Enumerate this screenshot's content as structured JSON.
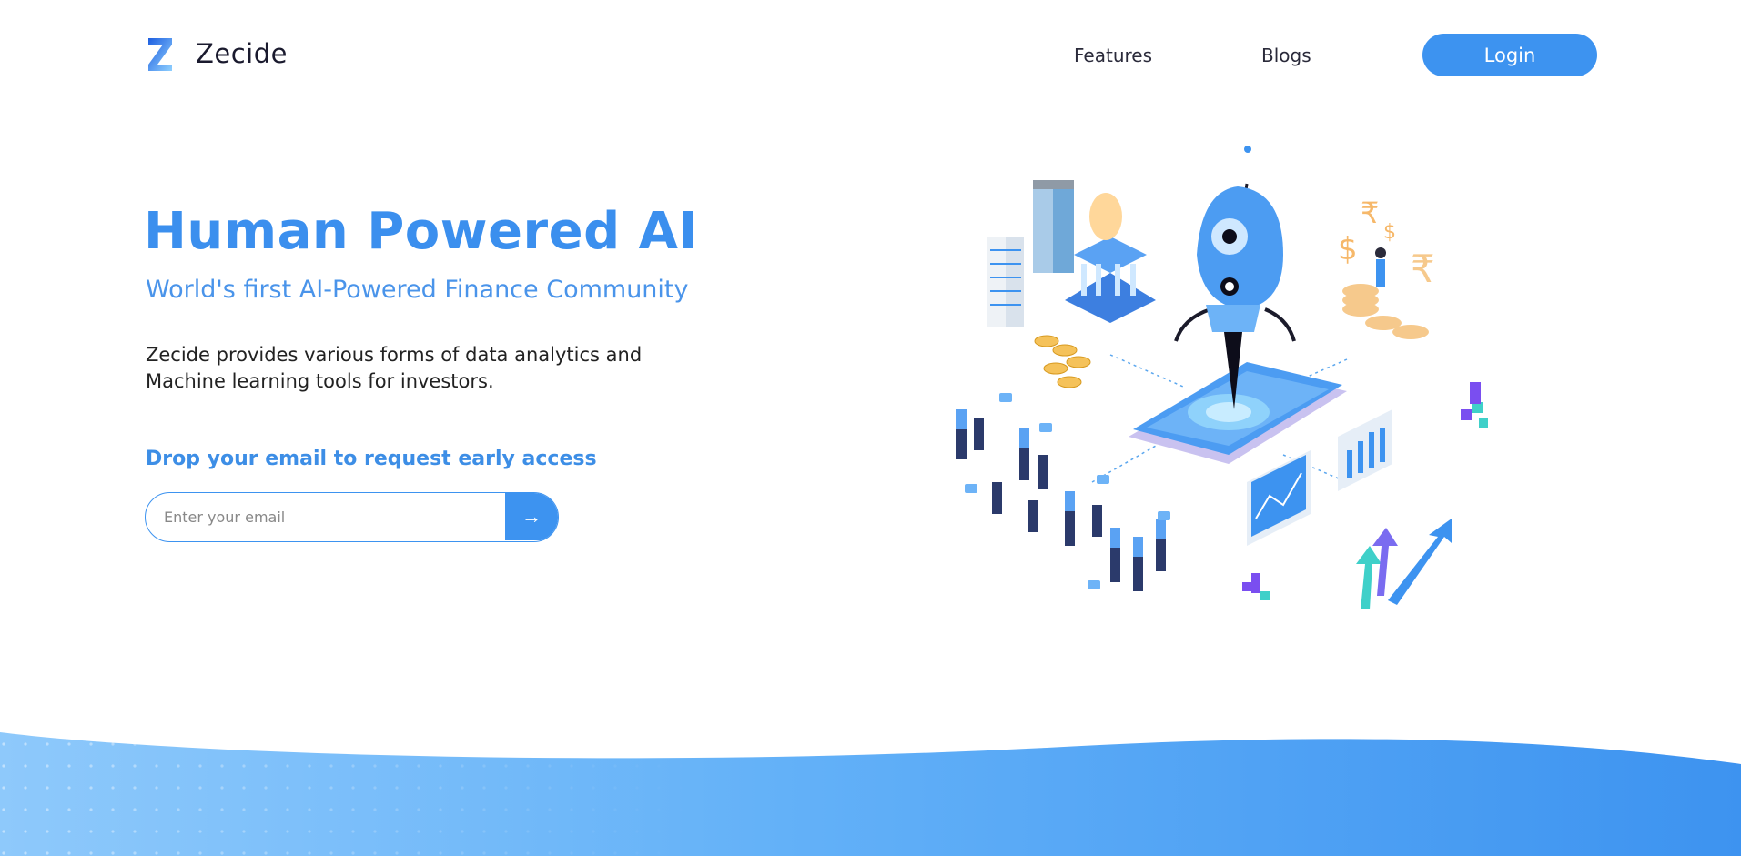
{
  "brand": {
    "name": "Zecide",
    "logo_icon": "z-logo-icon"
  },
  "nav": {
    "items": [
      {
        "label": "Features"
      },
      {
        "label": "Blogs"
      }
    ],
    "login_label": "Login"
  },
  "hero": {
    "title": "Human Powered AI",
    "subtitle": "World's first AI-Powered Finance Community",
    "description": "Zecide provides various forms of data analytics and Machine learning tools for investors.",
    "cta_label": "Drop your email to request early access",
    "email": {
      "placeholder": "Enter your email",
      "value": ""
    },
    "submit_icon": "arrow-right-icon",
    "submit_glyph": "→"
  },
  "colors": {
    "accent": "#3d93f0",
    "title": "#3b8fee",
    "text": "#222222",
    "wave_light": "#8ec9fb",
    "wave_dark": "#3d93f0"
  }
}
